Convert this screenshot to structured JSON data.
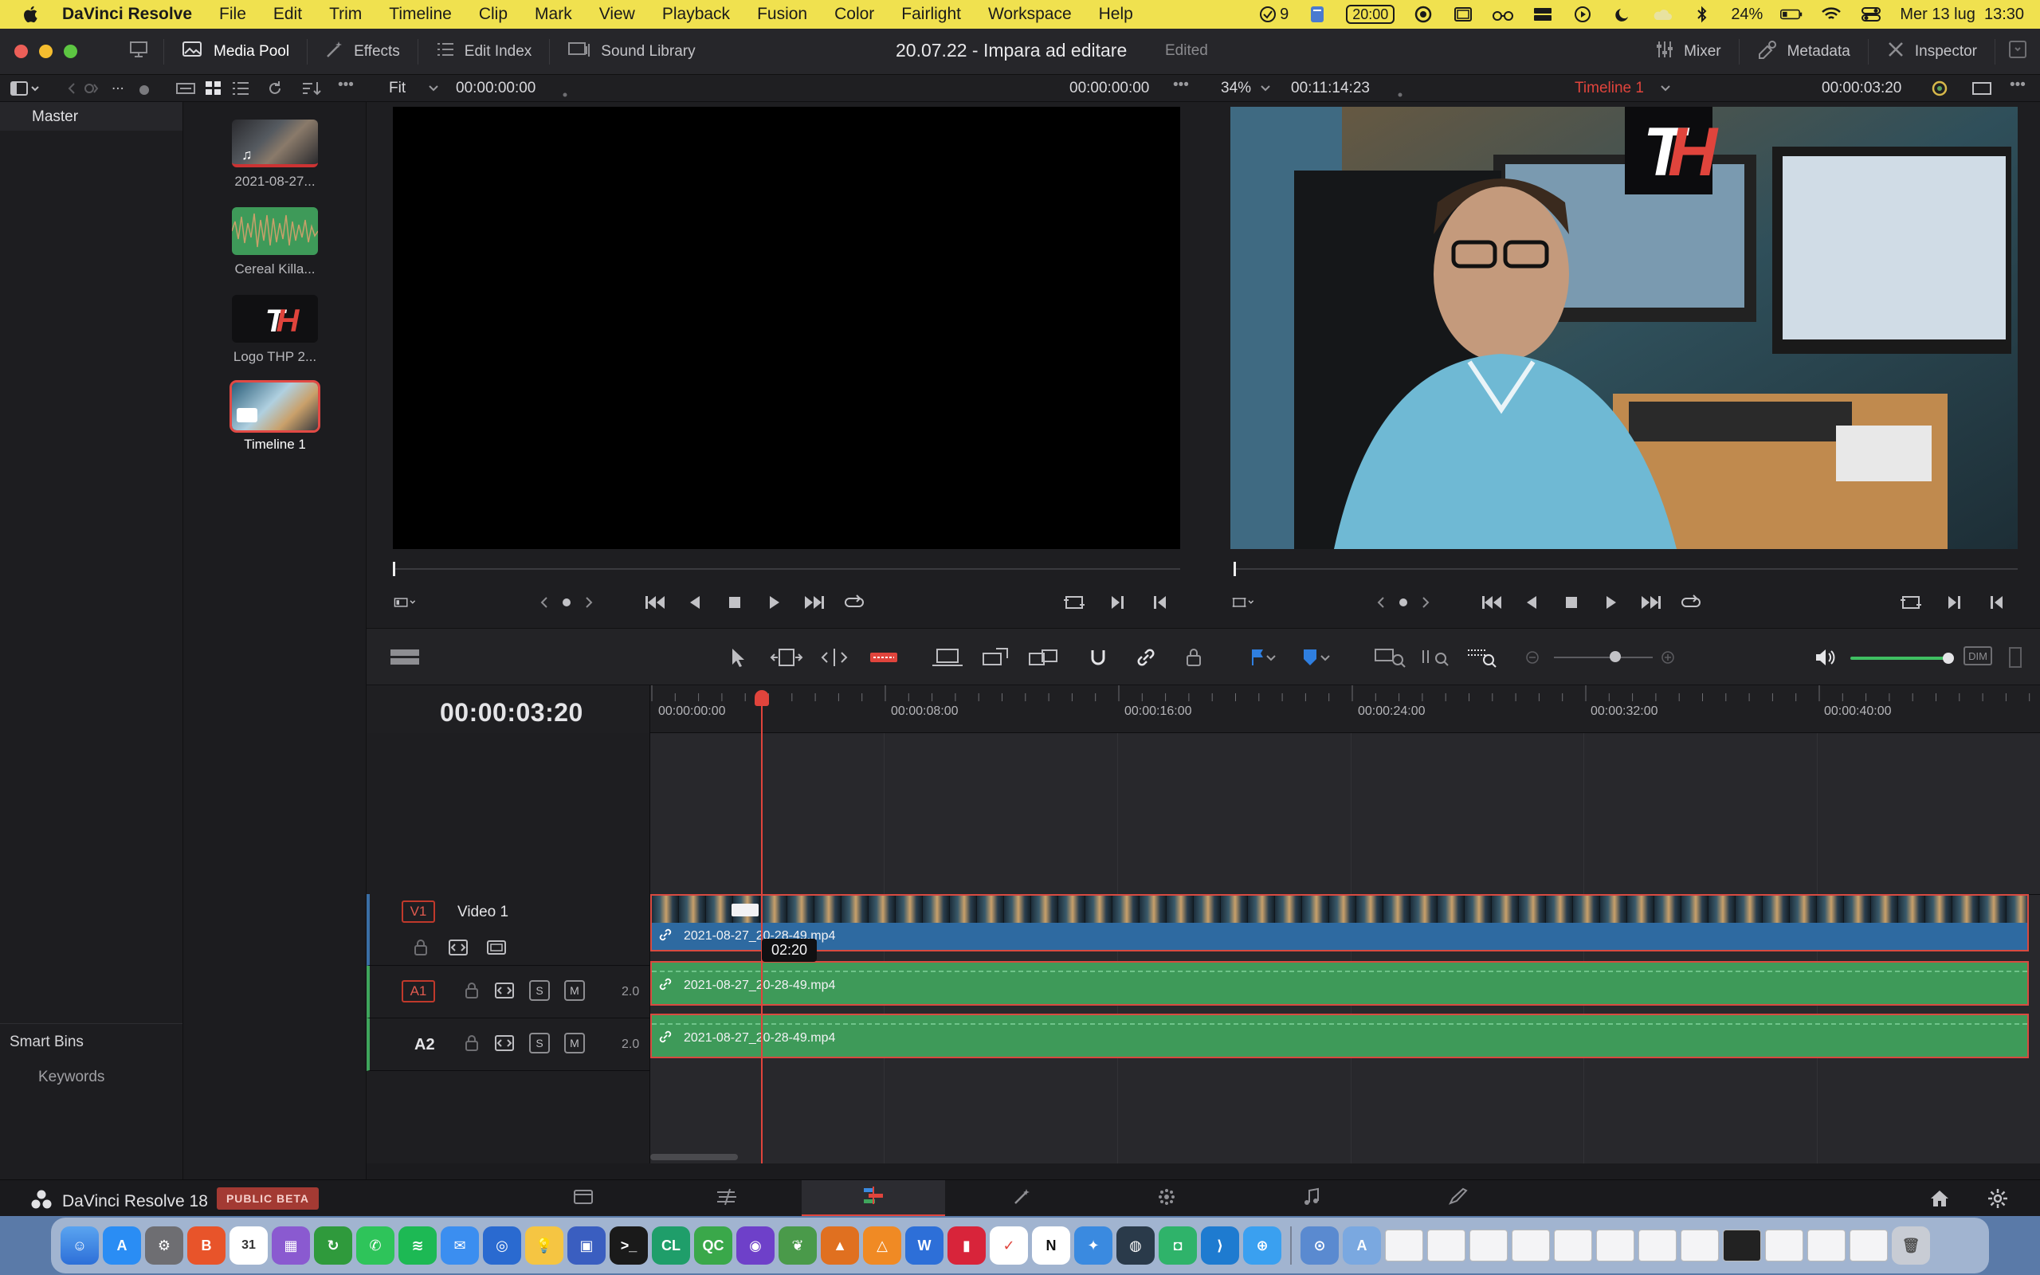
{
  "menubar": {
    "app_name": "DaVinci Resolve",
    "menus": [
      "File",
      "Edit",
      "Trim",
      "Timeline",
      "Clip",
      "Mark",
      "View",
      "Playback",
      "Fusion",
      "Color",
      "Fairlight",
      "Workspace",
      "Help"
    ],
    "status_count": "9",
    "clock_badge": "20:00",
    "battery": "24%",
    "datetime": "Mer 13 lug  13:30"
  },
  "topbar": {
    "media_pool": "Media Pool",
    "effects": "Effects",
    "edit_index": "Edit Index",
    "sound_library": "Sound Library",
    "project_title": "20.07.22 - Impara ad editare",
    "project_status": "Edited",
    "mixer": "Mixer",
    "metadata": "Metadata",
    "inspector": "Inspector"
  },
  "secbar": {
    "fit": "Fit",
    "source_tc": "00:00:00:00",
    "source_tc_right": "00:00:00:00",
    "zoom": "34%",
    "duration": "00:11:14:23",
    "timeline_name": "Timeline 1",
    "program_tc": "00:00:03:20"
  },
  "bins": {
    "master": "Master",
    "smart_bins": "Smart Bins",
    "keywords": "Keywords"
  },
  "pool_clips": [
    {
      "label": "2021-08-27..."
    },
    {
      "label": "Cereal Killa..."
    },
    {
      "label": "Logo THP 2..."
    },
    {
      "label": "Timeline 1"
    }
  ],
  "timeline": {
    "timecode": "00:00:03:20",
    "ruler": [
      "00:00:00:00",
      "00:00:08:00",
      "00:00:16:00",
      "00:00:24:00",
      "00:00:32:00",
      "00:00:40:00"
    ],
    "tracks": {
      "v1_tag": "V1",
      "v1_name": "Video 1",
      "a1_tag": "A1",
      "a2_tag": "A2",
      "a1_channels": "2.0",
      "a2_channels": "2.0",
      "solo": "S",
      "mute": "M"
    },
    "video_clip_name": "2021-08-27_20-28-49.mp4",
    "audio_clip_name_1": "2021-08-27_20-28-49.mp4",
    "audio_clip_name_2": "2021-08-27_20-28-49.mp4",
    "tooltip": "02:20",
    "dim": "DIM"
  },
  "pagebar": {
    "brand": "DaVinci Resolve 18",
    "beta": "PUBLIC BETA"
  },
  "logo_text": "TH",
  "colors": {
    "menubar_bg": "#f0e14f",
    "accent_red": "#e0443c",
    "video_clip_blue": "#2e6aa1",
    "audio_clip_green": "#3e9a59"
  }
}
